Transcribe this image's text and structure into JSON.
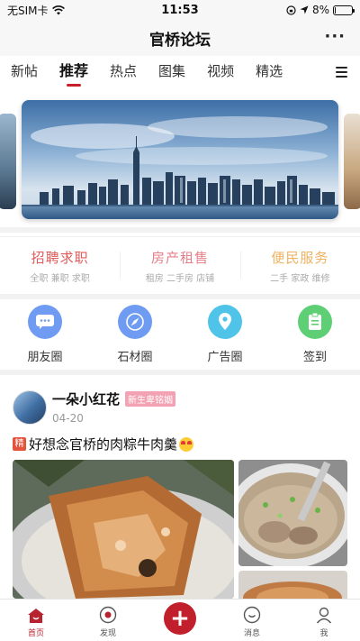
{
  "status_bar": {
    "carrier": "无SIM卡",
    "time": "11:53",
    "battery": "8%",
    "battery_level": 0.08
  },
  "header": {
    "title": "官桥论坛",
    "more": "···"
  },
  "tabs": [
    {
      "label": "新帖"
    },
    {
      "label": "推荐",
      "active": true
    },
    {
      "label": "热点"
    },
    {
      "label": "图集"
    },
    {
      "label": "视频"
    },
    {
      "label": "精选"
    }
  ],
  "categories": [
    {
      "title": "招聘求职",
      "sub": "全职 兼职 求职",
      "color": "#e05a5a"
    },
    {
      "title": "房产租售",
      "sub": "租房 二手房 店铺",
      "color": "#e77f8a"
    },
    {
      "title": "便民服务",
      "sub": "二手 家政 维修",
      "color": "#eeb25f"
    }
  ],
  "icons": [
    {
      "label": "朋友圈",
      "icon": "chat-bubble-icon",
      "color": "#6f9cf2"
    },
    {
      "label": "石材圈",
      "icon": "compass-icon",
      "color": "#6f9cf2"
    },
    {
      "label": "广告圈",
      "icon": "location-pin-icon",
      "color": "#4fc3e8"
    },
    {
      "label": "签到",
      "icon": "checklist-icon",
      "color": "#5ecf74"
    }
  ],
  "post": {
    "author": "一朵小红花",
    "badge": "新生卑铭姻",
    "date": "04-20",
    "tag": "精",
    "title": "好想念官桥的肉粽牛肉羹"
  },
  "bottom_nav": [
    {
      "label": "首页",
      "active": true
    },
    {
      "label": "发现"
    },
    {
      "label": "+"
    },
    {
      "label": "消息"
    },
    {
      "label": "我"
    }
  ],
  "colors": {
    "accent": "#c11f2c",
    "nav_active": "#b7232e"
  }
}
